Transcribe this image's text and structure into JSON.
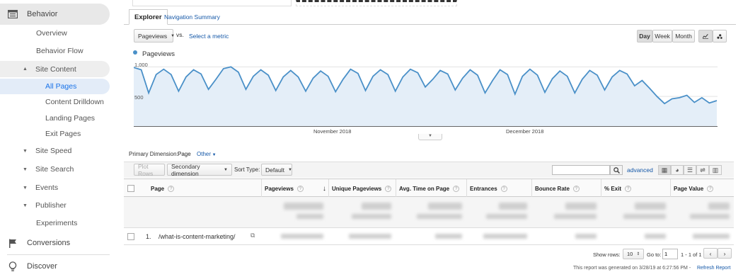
{
  "sidebar": {
    "behavior": "Behavior",
    "overview": "Overview",
    "behavior_flow": "Behavior Flow",
    "site_content": "Site Content",
    "all_pages": "All Pages",
    "content_drilldown": "Content Drilldown",
    "landing_pages": "Landing Pages",
    "exit_pages": "Exit Pages",
    "site_speed": "Site Speed",
    "site_search": "Site Search",
    "events": "Events",
    "publisher": "Publisher",
    "experiments": "Experiments",
    "conversions": "Conversions",
    "discover": "Discover"
  },
  "tabs": {
    "explorer": "Explorer",
    "navigation_summary": "Navigation Summary"
  },
  "controls": {
    "metric": "Pageviews",
    "vs": "vs.",
    "select_metric": "Select a metric",
    "day": "Day",
    "week": "Week",
    "month": "Month"
  },
  "chart_data": {
    "type": "line",
    "legend": "Pageviews",
    "series_color": "#4a90c8",
    "y_ticks": [
      "1,000",
      "500"
    ],
    "x_labels": [
      "November 2018",
      "December 2018"
    ],
    "ylim": [
      0,
      1100
    ],
    "values": [
      990,
      950,
      560,
      870,
      960,
      870,
      590,
      830,
      950,
      880,
      620,
      790,
      970,
      1000,
      910,
      620,
      840,
      950,
      860,
      600,
      830,
      940,
      830,
      590,
      810,
      930,
      840,
      580,
      790,
      960,
      890,
      600,
      840,
      950,
      870,
      590,
      830,
      960,
      900,
      660,
      790,
      940,
      880,
      610,
      810,
      950,
      860,
      560,
      770,
      950,
      870,
      540,
      840,
      960,
      860,
      570,
      800,
      930,
      840,
      560,
      790,
      940,
      860,
      610,
      830,
      940,
      880,
      680,
      770,
      640,
      500,
      380,
      460,
      480,
      520,
      400,
      480,
      390,
      430
    ]
  },
  "dimension": {
    "label": "Primary Dimension:",
    "value": "Page",
    "other": "Other"
  },
  "toolbar": {
    "plot_rows": "Plot Rows",
    "secondary_dimension": "Secondary dimension",
    "sort_type_label": "Sort Type:",
    "sort_type": "Default",
    "advanced": "advanced"
  },
  "table": {
    "columns": [
      "Page",
      "Pageviews",
      "Unique Pageviews",
      "Avg. Time on Page",
      "Entrances",
      "Bounce Rate",
      "% Exit",
      "Page Value"
    ],
    "rows": [
      {
        "index": "1.",
        "page": "/what-is-content-marketing/"
      }
    ]
  },
  "footer": {
    "show_rows_label": "Show rows:",
    "show_rows": "10",
    "goto_label": "Go to:",
    "goto": "1",
    "range": "1 - 1 of 1",
    "generated": "This report was generated on 3/28/19 at 6:27:56 PM -",
    "refresh": "Refresh Report"
  }
}
